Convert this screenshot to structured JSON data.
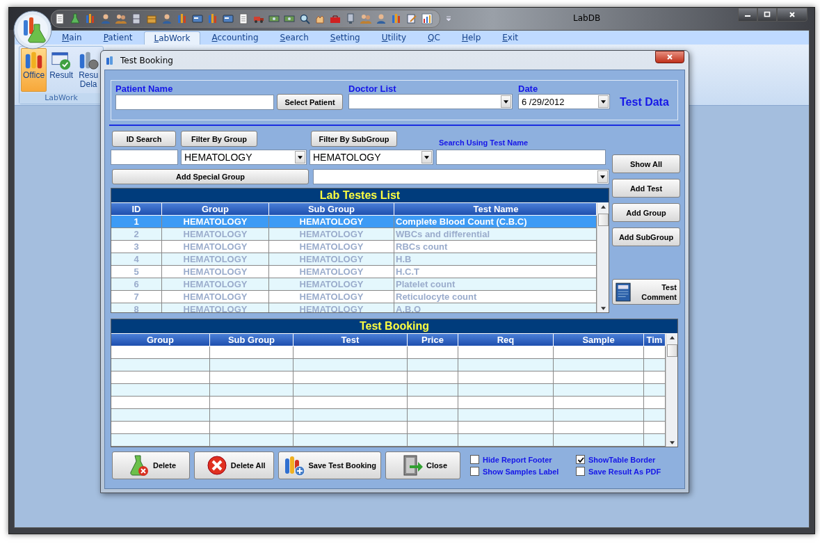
{
  "window": {
    "title": "LabDB"
  },
  "menu_tabs": [
    {
      "label": "Main",
      "selected": false
    },
    {
      "label": "Patient",
      "selected": false
    },
    {
      "label": "LabWork",
      "selected": true
    },
    {
      "label": "Accounting",
      "selected": false
    },
    {
      "label": "Search",
      "selected": false
    },
    {
      "label": "Setting",
      "selected": false
    },
    {
      "label": "Utility",
      "selected": false
    },
    {
      "label": "QC",
      "selected": false
    },
    {
      "label": "Help",
      "selected": false
    },
    {
      "label": "Exit",
      "selected": false
    }
  ],
  "ribbon": {
    "group_label": "LabWork",
    "items": [
      {
        "lines": [
          "Office"
        ],
        "selected": true,
        "kind": "office"
      },
      {
        "lines": [
          "Result"
        ],
        "selected": false,
        "kind": "result"
      },
      {
        "lines": [
          "Resu",
          "Dela"
        ],
        "selected": false,
        "kind": "delay"
      }
    ]
  },
  "dialog": {
    "title": "Test Booking",
    "patient_name": {
      "label": "Patient Name"
    },
    "select_patient_button": "Select Patient",
    "doctor_list": {
      "label": "Doctor List"
    },
    "date": {
      "label": "Date",
      "value": "6 /29/2012"
    },
    "test_data_label": "Test Data",
    "id_search_button": "ID Search",
    "filter_group_button": "Filter By Group",
    "filter_subgroup_button": "Filter By SubGroup",
    "search_label": "Search Using Test Name",
    "group_select": {
      "value": "HEMATOLOGY"
    },
    "subgroup_select": {
      "value": "HEMATOLOGY"
    },
    "add_special_group_button": "Add Special Group",
    "side_buttons": [
      "Show All",
      "Add Test",
      "Add Group",
      "Add SubGroup"
    ],
    "test_comment_button": "Test Comment",
    "lab_tests": {
      "title": "Lab Testes List",
      "columns": [
        "ID",
        "Group",
        "Sub Group",
        "Test Name"
      ],
      "rows": [
        {
          "cells": [
            "1",
            "HEMATOLOGY",
            "HEMATOLOGY",
            "Complete Blood Count (C.B.C)"
          ],
          "selected": true
        },
        {
          "cells": [
            "2",
            "HEMATOLOGY",
            "HEMATOLOGY",
            "WBCs and differential"
          ],
          "selected": false
        },
        {
          "cells": [
            "3",
            "HEMATOLOGY",
            "HEMATOLOGY",
            "RBCs count"
          ],
          "selected": false
        },
        {
          "cells": [
            "4",
            "HEMATOLOGY",
            "HEMATOLOGY",
            "H.B"
          ],
          "selected": false
        },
        {
          "cells": [
            "5",
            "HEMATOLOGY",
            "HEMATOLOGY",
            "H.C.T"
          ],
          "selected": false
        },
        {
          "cells": [
            "6",
            "HEMATOLOGY",
            "HEMATOLOGY",
            "Platelet count"
          ],
          "selected": false
        },
        {
          "cells": [
            "7",
            "HEMATOLOGY",
            "HEMATOLOGY",
            "Reticulocyte count"
          ],
          "selected": false
        },
        {
          "cells": [
            "8",
            "HEMATOLOGY",
            "HEMATOLOGY",
            "A.B.O"
          ],
          "selected": false
        }
      ]
    },
    "booking": {
      "title": "Test Booking",
      "columns": [
        "Group",
        "Sub Group",
        "Test",
        "Price",
        "Req",
        "Sample",
        "Tim"
      ]
    },
    "actions": [
      {
        "label": "Delete",
        "kind": "delete"
      },
      {
        "label": "Delete All",
        "kind": "delete_all"
      },
      {
        "label": "Save Test Booking",
        "kind": "save"
      },
      {
        "label": "Close",
        "kind": "close"
      }
    ],
    "options": [
      {
        "label": "Hide Report Footer",
        "checked": false
      },
      {
        "label": "Show Samples Label",
        "checked": false
      },
      {
        "label": "ShowTable Border",
        "checked": true
      },
      {
        "label": "Save Result As PDF",
        "checked": false
      }
    ]
  }
}
